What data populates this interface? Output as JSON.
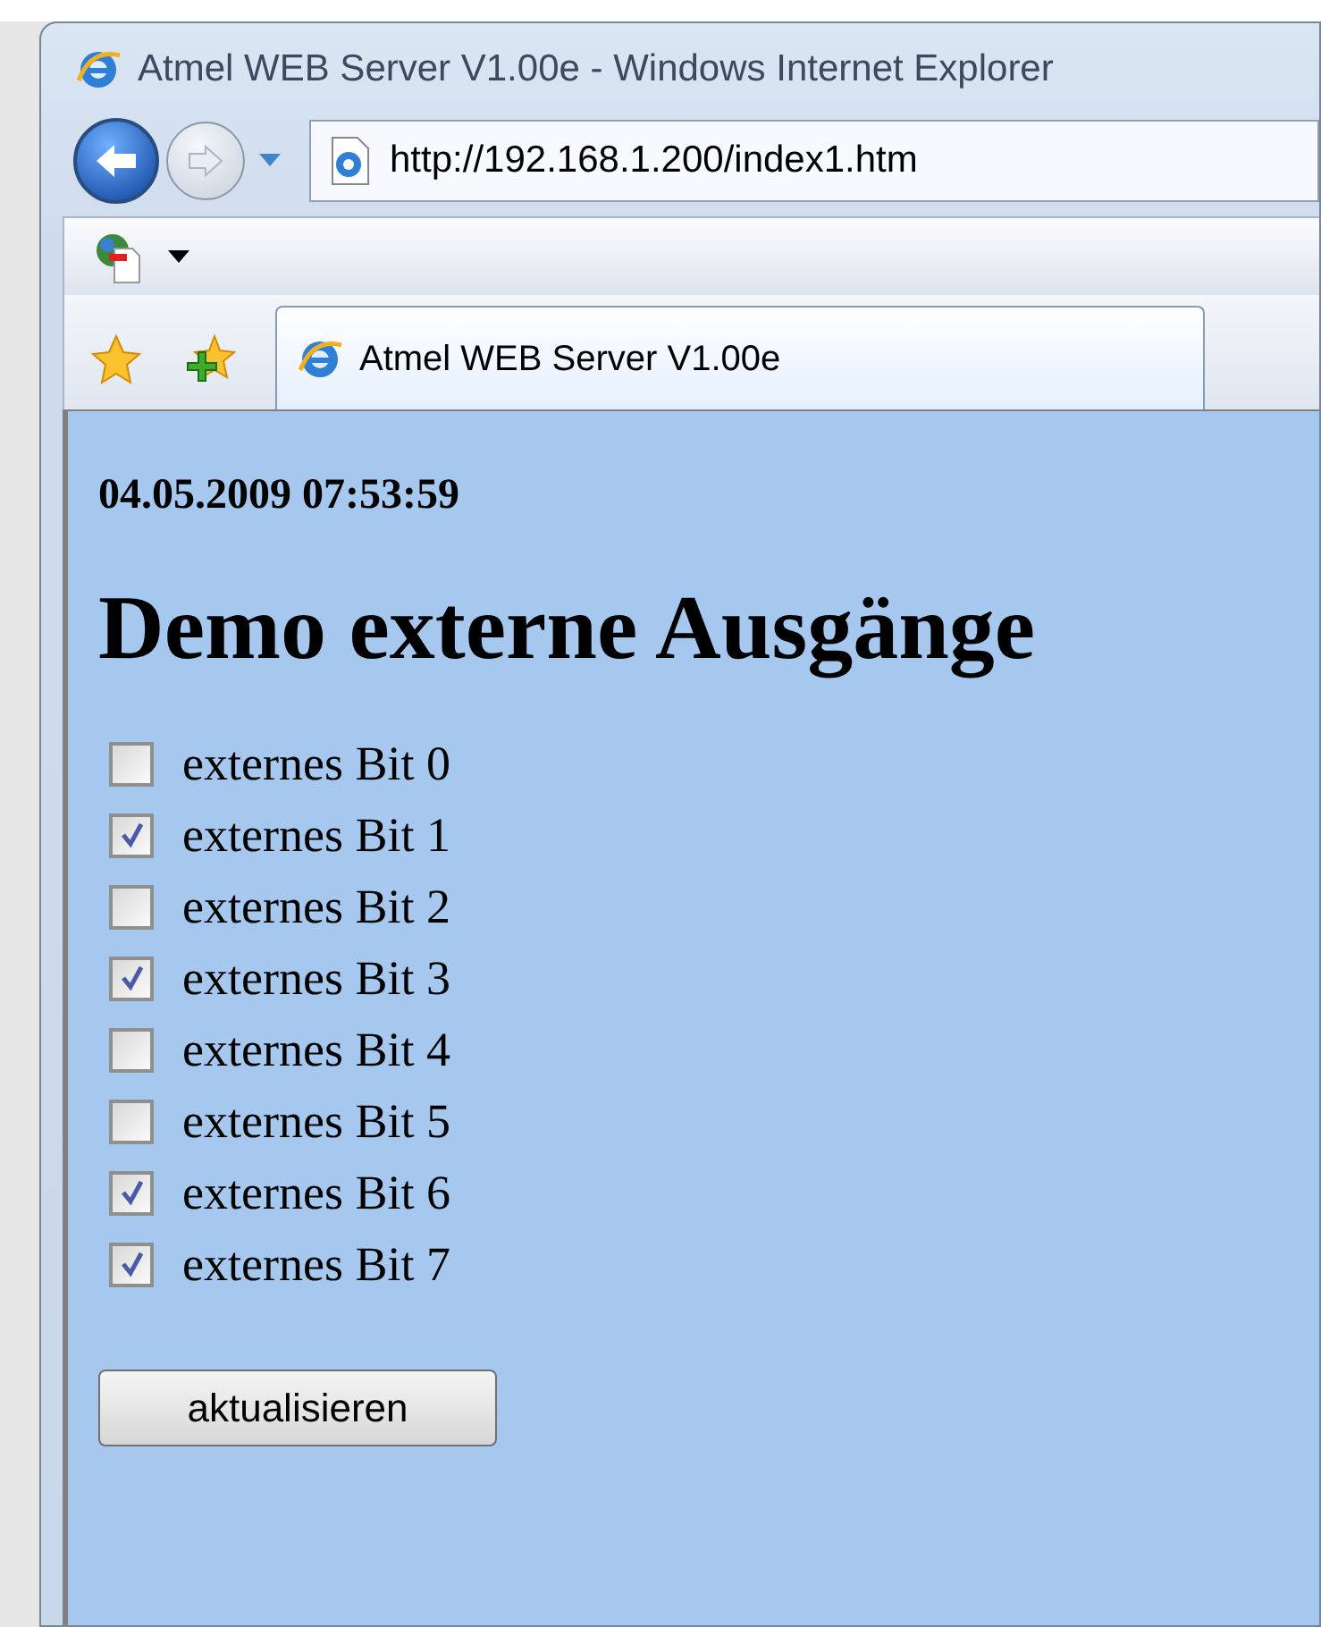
{
  "window": {
    "title": "Atmel WEB Server V1.00e - Windows Internet Explorer"
  },
  "address_bar": {
    "value": "http://192.168.1.200/index1.htm"
  },
  "tabs": [
    {
      "label": "Atmel WEB Server V1.00e",
      "selected": true
    }
  ],
  "page": {
    "timestamp": "04.05.2009 07:53:59",
    "heading": "Demo externe Ausgänge",
    "bits": [
      {
        "label": "externes Bit 0",
        "checked": false
      },
      {
        "label": "externes Bit 1",
        "checked": true
      },
      {
        "label": "externes Bit 2",
        "checked": false
      },
      {
        "label": "externes Bit 3",
        "checked": true
      },
      {
        "label": "externes Bit 4",
        "checked": false
      },
      {
        "label": "externes Bit 5",
        "checked": false
      },
      {
        "label": "externes Bit 6",
        "checked": true
      },
      {
        "label": "externes Bit 7",
        "checked": true
      }
    ],
    "button": "aktualisieren"
  }
}
